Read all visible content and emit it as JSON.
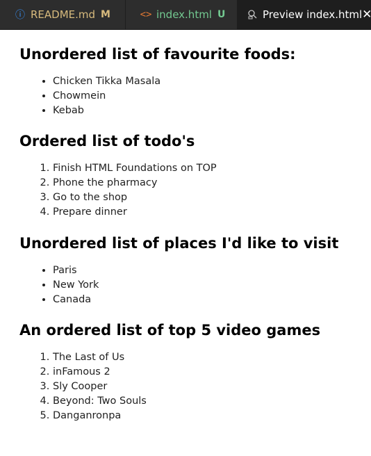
{
  "tabs": [
    {
      "label": "README.md",
      "badge": "M",
      "icon": "info-icon"
    },
    {
      "label": "index.html",
      "badge": "U",
      "icon": "code-icon"
    },
    {
      "label": "Preview index.html",
      "icon": "preview-icon",
      "close": "close-icon"
    }
  ],
  "sections": [
    {
      "heading": "Unordered list of favourite foods:",
      "items": [
        "Chicken Tikka Masala",
        "Chowmein",
        "Kebab"
      ]
    },
    {
      "heading": "Ordered list of todo's",
      "items": [
        "Finish HTML Foundations on TOP",
        "Phone the pharmacy",
        "Go to the shop",
        "Prepare dinner"
      ]
    },
    {
      "heading": "Unordered list of places I'd like to visit",
      "items": [
        "Paris",
        "New York",
        "Canada"
      ]
    },
    {
      "heading": "An ordered list of top 5 video games",
      "items": [
        "The Last of Us",
        "inFamous 2",
        "Sly Cooper",
        "Beyond: Two Souls",
        "Danganronpa"
      ]
    }
  ],
  "colors": {
    "tab_bg": "#252526",
    "active_tab_bg": "#1e1e1e",
    "modified": "#d7ba7d",
    "untracked": "#73c991"
  }
}
